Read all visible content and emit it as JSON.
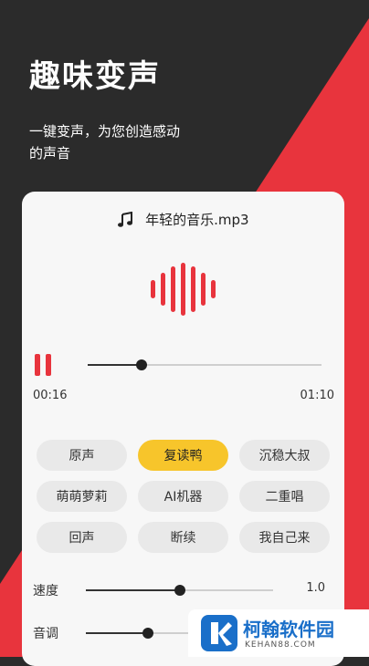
{
  "promo": {
    "title": "趣味变声",
    "subtitle": "一键变声，为您创造感动的声音"
  },
  "player": {
    "file_name": "年轻的音乐.mp3",
    "current_time": "00:16",
    "total_time": "01:10",
    "progress": 0.23,
    "state": "playing"
  },
  "effects": [
    {
      "label": "原声",
      "active": false
    },
    {
      "label": "复读鸭",
      "active": true
    },
    {
      "label": "沉稳大叔",
      "active": false
    },
    {
      "label": "萌萌萝莉",
      "active": false
    },
    {
      "label": "AI机器",
      "active": false
    },
    {
      "label": "二重唱",
      "active": false
    },
    {
      "label": "回声",
      "active": false
    },
    {
      "label": "断续",
      "active": false
    },
    {
      "label": "我自己来",
      "active": false
    }
  ],
  "controls": {
    "speed": {
      "label": "速度",
      "value": "1.0",
      "level": 0.5
    },
    "pitch": {
      "label": "音调",
      "level": 0.33
    }
  },
  "watermark": {
    "name": "柯翰软件园",
    "url": "KEHAN88.COM"
  },
  "colors": {
    "accent_red": "#e8343d",
    "active_chip": "#f7c52b",
    "dark_bg": "#2b2b2b"
  }
}
